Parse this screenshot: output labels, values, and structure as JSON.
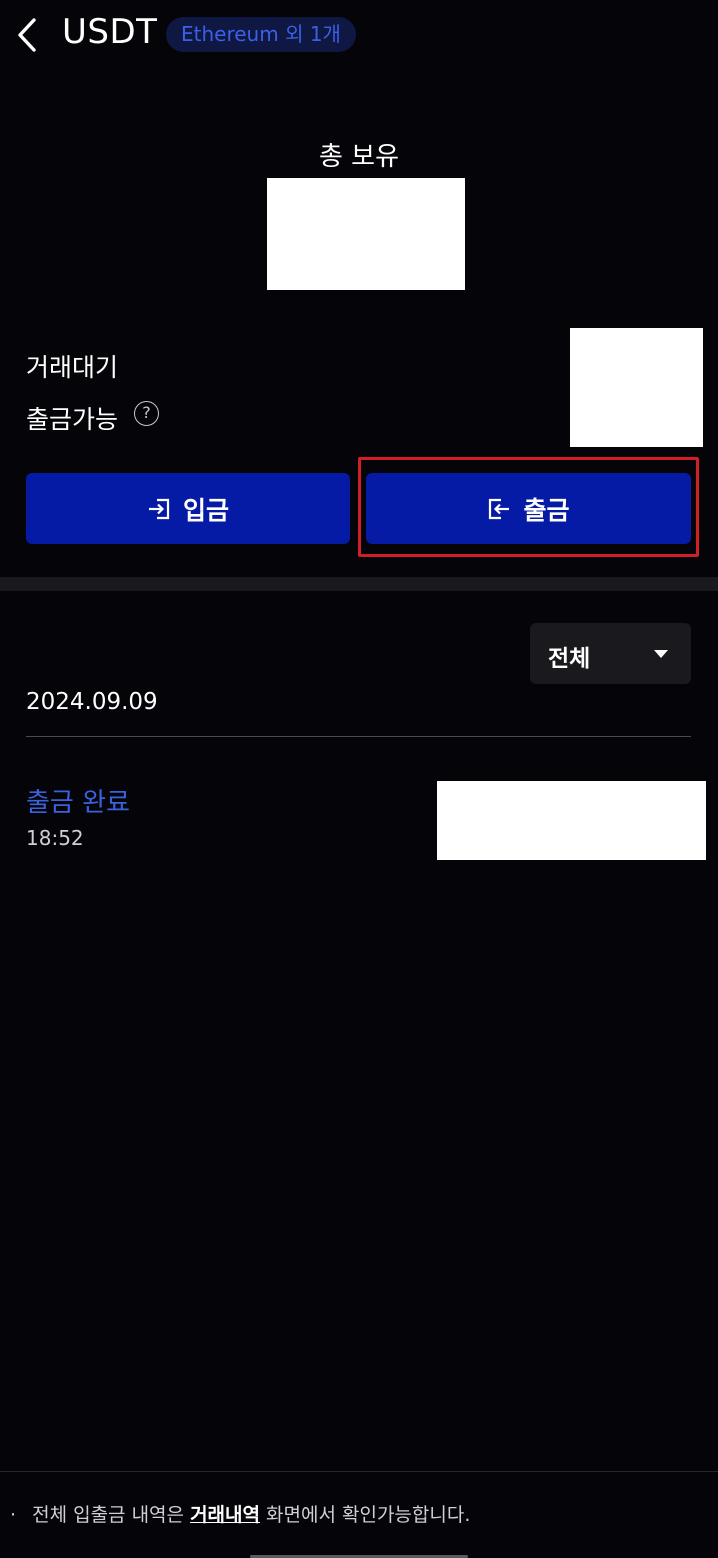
{
  "header": {
    "title": "USDT",
    "network_badge": "Ethereum 외 1개"
  },
  "balance": {
    "total_label": "총 보유",
    "pending_label": "거래대기",
    "available_label": "출금가능",
    "help_icon": "question-circle-icon"
  },
  "actions": {
    "deposit_label": "입금",
    "withdraw_label": "출금"
  },
  "filter": {
    "selected": "전체"
  },
  "history": {
    "date": "2024.09.09",
    "items": [
      {
        "status": "출금 완료",
        "time": "18:52"
      }
    ]
  },
  "footer": {
    "bullet": "·",
    "note_prefix": "전체 입출금 내역은",
    "link_text": "거래내역",
    "note_suffix": "화면에서 확인가능합니다."
  },
  "colors": {
    "background": "#050408",
    "button": "#061ba5",
    "badge_bg": "#0f1842",
    "accent_blue": "#3a62e0",
    "highlight_red": "#d11f27",
    "panel": "#1a191e"
  }
}
